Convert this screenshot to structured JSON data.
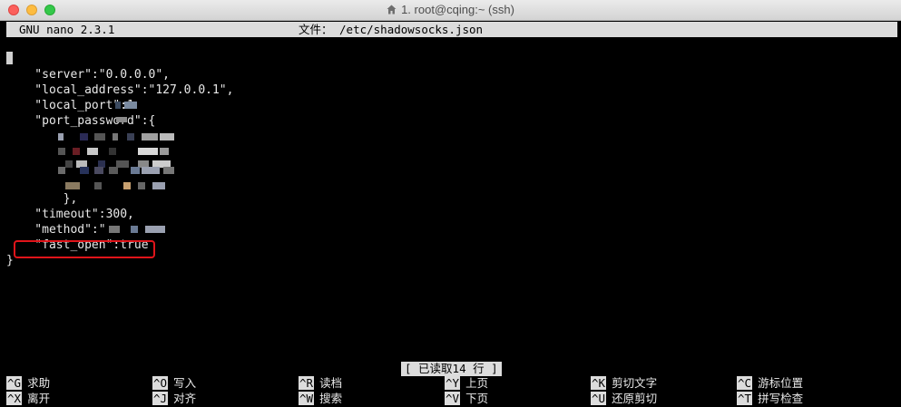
{
  "window": {
    "title": "1. root@cqing:~ (ssh)"
  },
  "nano": {
    "version": "GNU nano 2.3.1",
    "file_label": "文件： /etc/shadowsocks.json",
    "status": "[ 已读取14 行 ]"
  },
  "code_lines": [
    "{",
    "    \"server\":\"0.0.0.0\",",
    "    \"local_address\":\"127.0.0.1\",",
    "    \"local_port\":1",
    "    \"port_password\":{",
    "",
    "",
    "",
    "",
    "        },",
    "    \"timeout\":300,",
    "    \"method\":\"",
    "    \"fast_open\":true",
    "}"
  ],
  "shortcuts": [
    {
      "key": "^G",
      "label": "求助"
    },
    {
      "key": "^X",
      "label": "离开"
    },
    {
      "key": "^O",
      "label": "写入"
    },
    {
      "key": "^J",
      "label": "对齐"
    },
    {
      "key": "^R",
      "label": "读档"
    },
    {
      "key": "^W",
      "label": "搜索"
    },
    {
      "key": "^Y",
      "label": "上页"
    },
    {
      "key": "^V",
      "label": "下页"
    },
    {
      "key": "^K",
      "label": "剪切文字"
    },
    {
      "key": "^U",
      "label": "还原剪切"
    },
    {
      "key": "^C",
      "label": "游标位置"
    },
    {
      "key": "^T",
      "label": "拼写检查"
    }
  ],
  "colors": {
    "highlight_box": "#e0141a",
    "bar_bg": "#dcdcdc",
    "terminal_bg": "#000000"
  }
}
